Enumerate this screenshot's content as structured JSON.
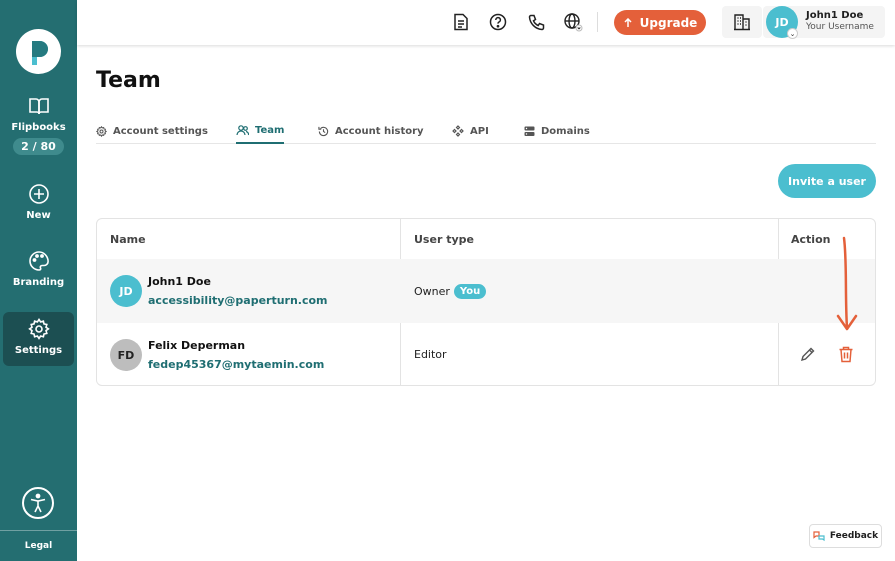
{
  "sidebar": {
    "flipbooks_label": "Flipbooks",
    "flipbooks_count": "2 / 80",
    "new_label": "New",
    "branding_label": "Branding",
    "settings_label": "Settings",
    "legal_label": "Legal"
  },
  "topbar": {
    "upgrade_label": "Upgrade",
    "user_initials": "JD",
    "user_name": "John1 Doe",
    "user_sub": "Your Username"
  },
  "page": {
    "title": "Team"
  },
  "tabs": [
    {
      "label": "Account settings",
      "icon": "gear-icon"
    },
    {
      "label": "Team",
      "icon": "users-icon",
      "active": true
    },
    {
      "label": "Account history",
      "icon": "history-icon"
    },
    {
      "label": "API",
      "icon": "api-icon"
    },
    {
      "label": "Domains",
      "icon": "server-icon"
    }
  ],
  "invite_label": "Invite a user",
  "table": {
    "headers": {
      "name": "Name",
      "user_type": "User type",
      "action": "Action"
    },
    "rows": [
      {
        "initials": "JD",
        "name": "John1 Doe",
        "email": "accessibility@paperturn.com",
        "type": "Owner",
        "badge": "You",
        "avatar_color": "#4bbecf"
      },
      {
        "initials": "FD",
        "name": "Felix Deperman",
        "email": "fedep45367@mytaemin.com",
        "type": "Editor",
        "avatar_color": "#bdbdbd"
      }
    ]
  },
  "feedback_label": "Feedback",
  "colors": {
    "sidebar": "#246e71",
    "accent": "#4bbecf",
    "upgrade": "#e4603a",
    "link": "#1f6e72"
  }
}
